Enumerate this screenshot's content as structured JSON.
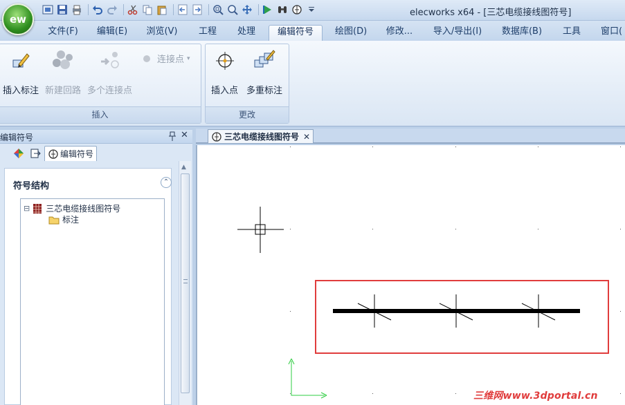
{
  "window": {
    "title": "elecworks x64 - [三芯电缆接线图符号]",
    "app_logo_text": "ew"
  },
  "quick_access": [
    {
      "icon": "home-icon"
    },
    {
      "icon": "save-icon"
    },
    {
      "icon": "print-icon"
    },
    {
      "icon": "undo-icon"
    },
    {
      "icon": "redo-icon"
    },
    {
      "icon": "cut-icon"
    },
    {
      "icon": "copy-icon"
    },
    {
      "icon": "paste-icon"
    },
    {
      "icon": "back-icon"
    },
    {
      "icon": "forward-icon"
    },
    {
      "icon": "zoom-window-icon"
    },
    {
      "icon": "zoom-icon"
    },
    {
      "icon": "pan-icon"
    },
    {
      "icon": "play-icon"
    },
    {
      "icon": "binoculars-icon"
    },
    {
      "icon": "symbol-icon"
    },
    {
      "icon": "dropdown-icon"
    }
  ],
  "tabs": [
    {
      "label": "文件(F)"
    },
    {
      "label": "编辑(E)"
    },
    {
      "label": "浏览(V)"
    },
    {
      "label": "工程"
    },
    {
      "label": "处理"
    },
    {
      "label": "编辑符号",
      "active": true
    },
    {
      "label": "绘图(D)"
    },
    {
      "label": "修改..."
    },
    {
      "label": "导入/导出(I)"
    },
    {
      "label": "数据库(B)"
    },
    {
      "label": "工具"
    },
    {
      "label": "窗口("
    }
  ],
  "ribbon": {
    "insert_group": {
      "label": "插入",
      "buttons": [
        {
          "label": "插入标注",
          "enabled": true
        },
        {
          "label": "新建回路",
          "enabled": false
        },
        {
          "label": "多个连接点",
          "enabled": false
        }
      ],
      "small_button": {
        "label": "连接点",
        "enabled": false
      }
    },
    "change_group": {
      "label": "更改",
      "buttons": [
        {
          "label": "插入点",
          "enabled": true
        },
        {
          "label": "多重标注",
          "enabled": true
        }
      ]
    }
  },
  "panel": {
    "title": "编辑符号",
    "close": "✕",
    "subtabs": [
      {
        "icon": "components-icon"
      },
      {
        "icon": "document-icon"
      },
      {
        "icon": "symbol-icon",
        "label": "编辑符号",
        "active": true
      }
    ],
    "section_title": "符号结构",
    "collapse": "⌃",
    "tree": [
      {
        "label": "三芯电缆接线图符号",
        "icon": "grid-icon",
        "expander": "⊟"
      },
      {
        "label": "标注",
        "icon": "folder-icon"
      }
    ]
  },
  "document": {
    "tab_label": "三芯电缆接线图符号",
    "tab_close": "✕"
  },
  "watermark": "三维网www.3dportal.cn",
  "colors": {
    "ribbon_bg": "#dae6f4",
    "highlight_box": "#e03c3c",
    "ucs_axis": "#2ecc40",
    "watermark": "#e03c3c"
  }
}
